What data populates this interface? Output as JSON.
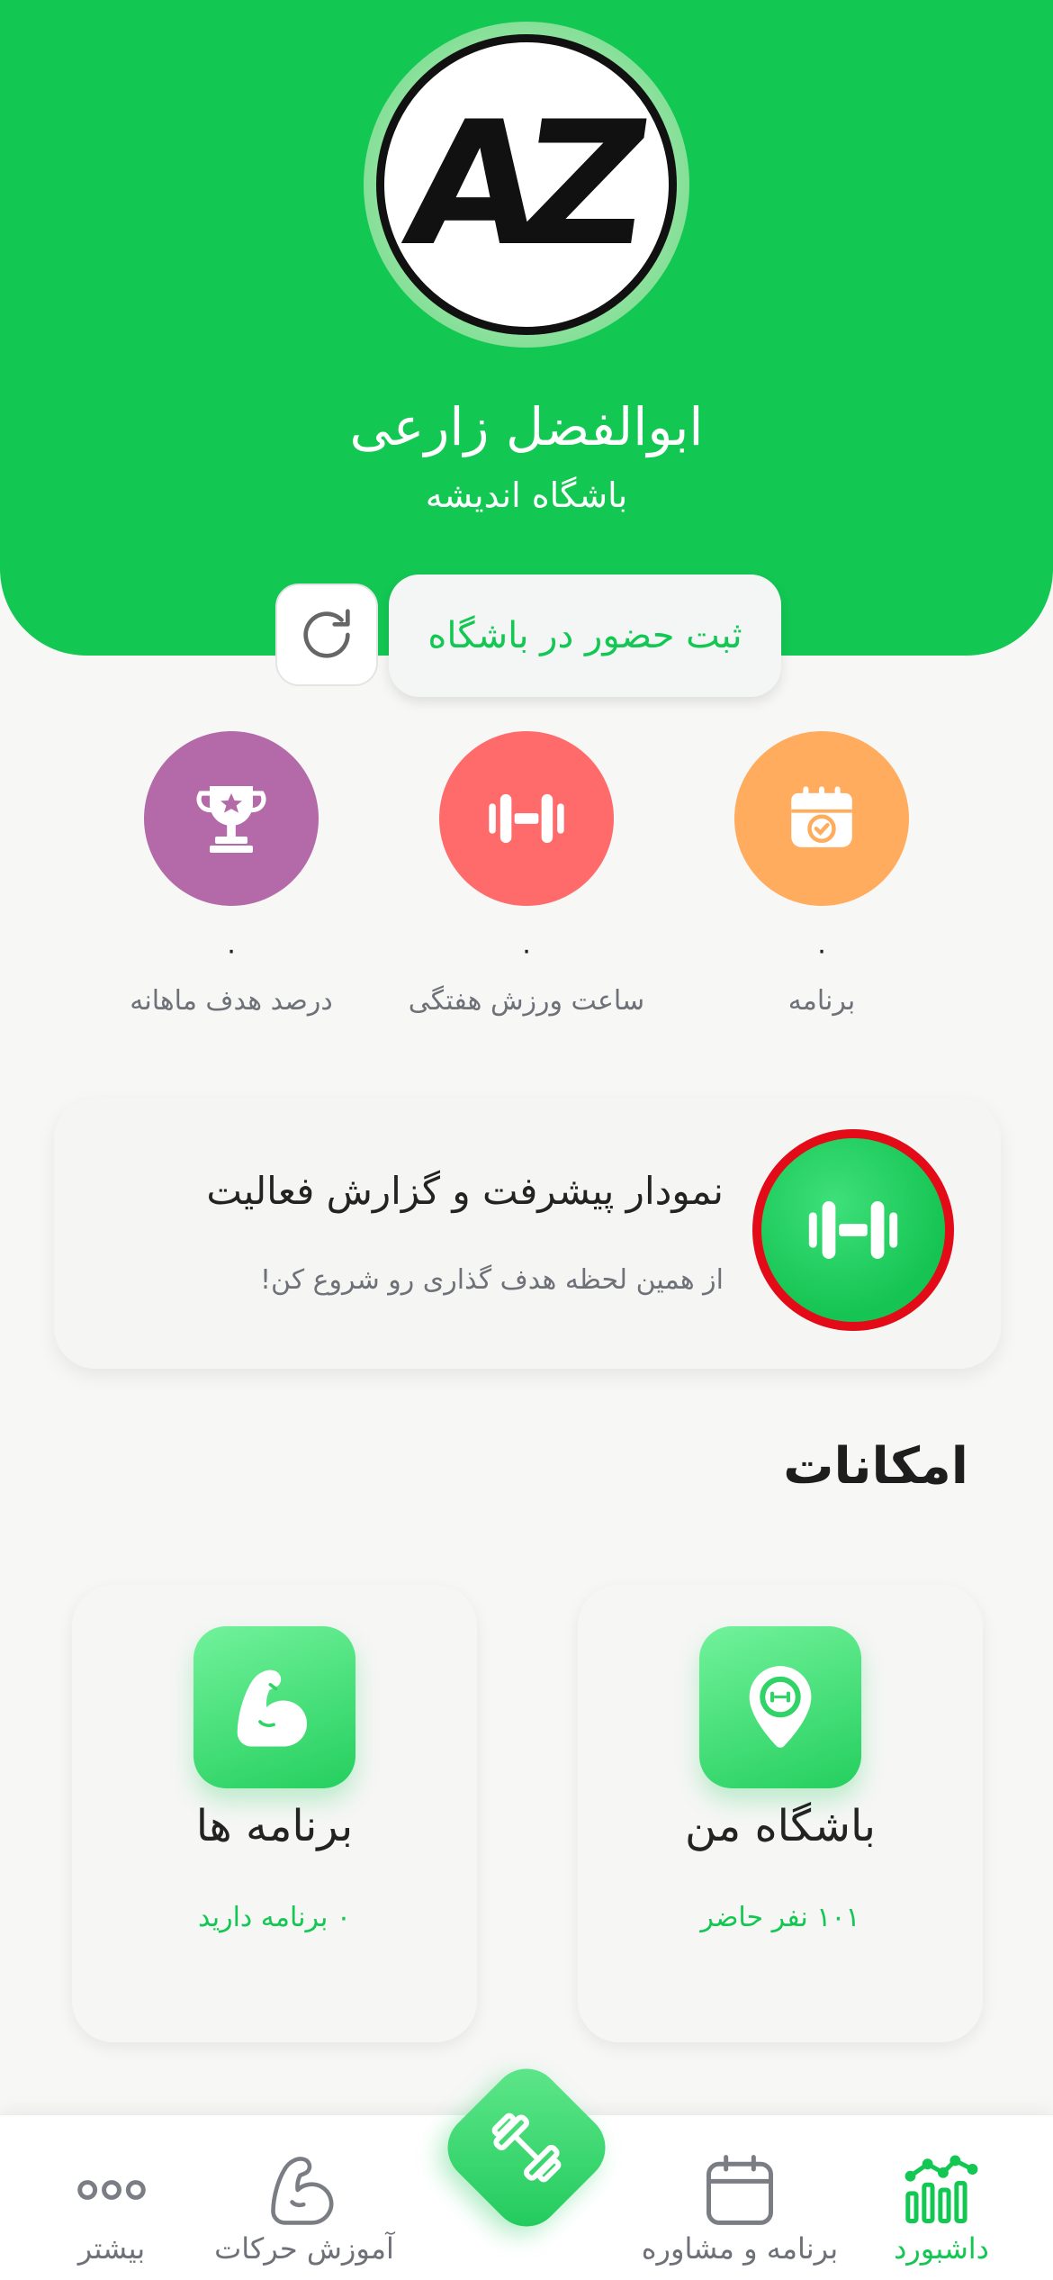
{
  "header": {
    "avatar_text": "AZ",
    "user_name": "ابوالفضل زارعی",
    "club_name": "باشگاه اندیشه",
    "checkin_label": "ثبت حضور در باشگاه"
  },
  "stats": [
    {
      "value": "۰",
      "label": "برنامه",
      "icon": "calendar-check-icon",
      "color": "#ffac5e"
    },
    {
      "value": "۰",
      "label": "ساعت ورزش هفتگی",
      "icon": "dumbbell-icon",
      "color": "#ff6b6b"
    },
    {
      "value": "۰",
      "label": "درصد هدف ماهانه",
      "icon": "trophy-icon",
      "color": "#b46aa8"
    }
  ],
  "progress_card": {
    "title": "نمودار پیشرفت و گزارش فعالیت",
    "subtitle": "از همین لحظه هدف گذاری رو شروع کن!"
  },
  "features": {
    "title": "امکانات",
    "items": [
      {
        "title": "باشگاه من",
        "subtitle": "۱۰۱ نفر حاضر",
        "icon": "location-pin-icon"
      },
      {
        "title": "برنامه ها",
        "subtitle": "۰ برنامه دارید",
        "icon": "flexed-arm-icon"
      }
    ]
  },
  "nav": {
    "items": [
      {
        "label": "داشبورد",
        "icon": "chart-icon",
        "active": true
      },
      {
        "label": "برنامه و مشاوره",
        "icon": "calendar-icon",
        "active": false
      },
      {
        "label": "آموزش حرکات",
        "icon": "arm-icon",
        "active": false
      },
      {
        "label": "بیشتر",
        "icon": "more-icon",
        "active": false
      }
    ],
    "fab_icon": "dumbbell-icon"
  },
  "colors": {
    "brand": "#13c753",
    "highlight_ring": "#e30b17"
  }
}
